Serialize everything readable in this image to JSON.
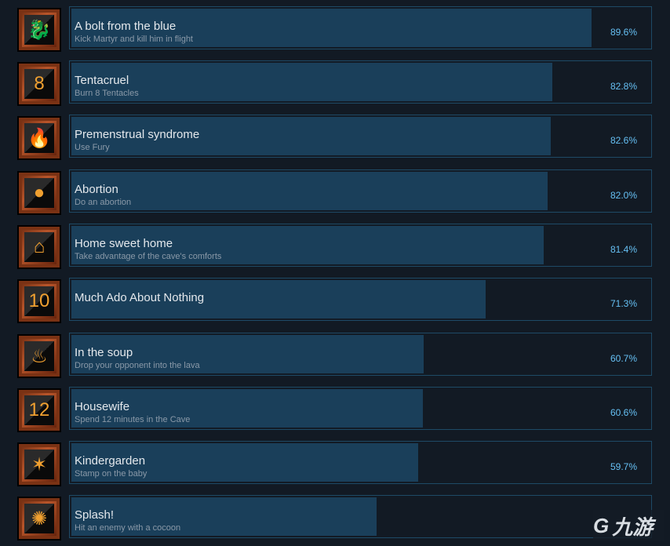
{
  "achievements": [
    {
      "title": "A bolt from the blue",
      "desc": "Kick Martyr and kill him in flight",
      "percent": "89.6%",
      "value": 89.6,
      "icon": "dragon-bolt-icon"
    },
    {
      "title": "Tentacruel",
      "desc": "Burn 8 Tentacles",
      "percent": "82.8%",
      "value": 82.8,
      "icon": "tentacles-8-icon"
    },
    {
      "title": "Premenstrual syndrome",
      "desc": "Use Fury",
      "percent": "82.6%",
      "value": 82.6,
      "icon": "fury-icon"
    },
    {
      "title": "Abortion",
      "desc": "Do an abortion",
      "percent": "82.0%",
      "value": 82.0,
      "icon": "abortion-icon"
    },
    {
      "title": "Home sweet home",
      "desc": "Take advantage of the cave's comforts",
      "percent": "81.4%",
      "value": 81.4,
      "icon": "home-icon"
    },
    {
      "title": "Much Ado About Nothing",
      "desc": "",
      "percent": "71.3%",
      "value": 71.3,
      "icon": "flame-10-icon"
    },
    {
      "title": "In the soup",
      "desc": "Drop your opponent into the lava",
      "percent": "60.7%",
      "value": 60.7,
      "icon": "lava-icon"
    },
    {
      "title": "Housewife",
      "desc": "Spend 12 minutes in the Cave",
      "percent": "60.6%",
      "value": 60.6,
      "icon": "12-min-icon"
    },
    {
      "title": "Kindergarden",
      "desc": "Stamp on the baby",
      "percent": "59.7%",
      "value": 59.7,
      "icon": "baby-stamp-icon"
    },
    {
      "title": "Splash!",
      "desc": "Hit an enemy with a cocoon",
      "percent": "",
      "value": 52.6,
      "icon": "cocoon-splash-icon"
    }
  ],
  "colors": {
    "background": "#121a24",
    "bar_fill": "#1a3f5a",
    "border": "#1e4a66",
    "percent": "#66c0f4"
  },
  "watermark": "九游"
}
